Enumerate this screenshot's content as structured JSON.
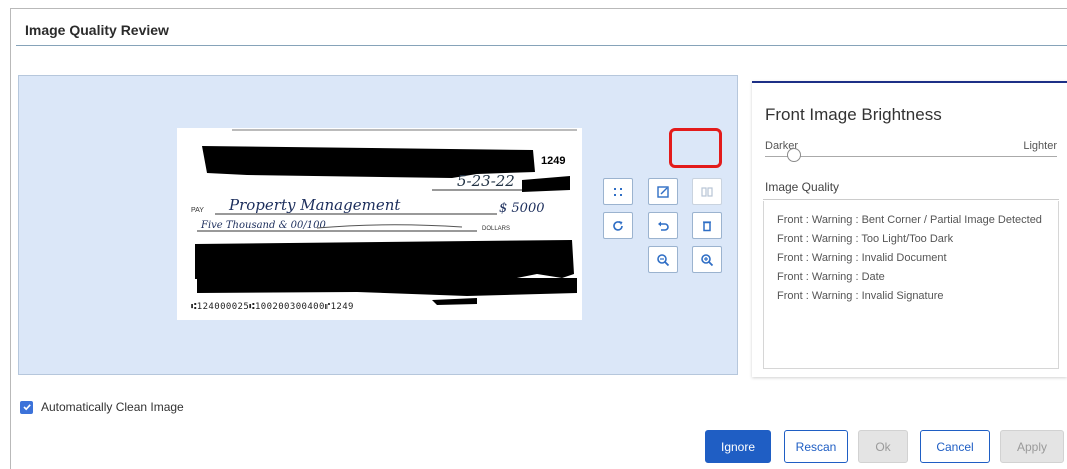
{
  "dialog": {
    "title": "Image Quality Review"
  },
  "check": {
    "check_number": "1249",
    "date": "5-23-22",
    "pay_prefix": "PAY",
    "payee": "Property Management",
    "amount": "$ 5000",
    "amount_words": "Five Thousand & 00/100",
    "dollars_suffix": "DOLLARS",
    "micr": "⑆124000025⑆100200300400⑈1249"
  },
  "toolbar": {
    "buttons": [
      {
        "name": "crop-button",
        "icon": "crop-icon"
      },
      {
        "name": "edit-button",
        "icon": "edit-icon"
      },
      {
        "name": "compare-button",
        "icon": "compare-icon",
        "disabled": true
      },
      {
        "name": "rotate-clockwise-button",
        "icon": "rotate-cw-icon"
      },
      {
        "name": "undo-button",
        "icon": "undo-icon"
      },
      {
        "name": "delete-button",
        "icon": "trash-icon",
        "highlighted": true
      },
      {
        "name": "zoom-out-button",
        "icon": "zoom-out-icon"
      },
      {
        "name": "zoom-in-button",
        "icon": "zoom-in-icon"
      }
    ]
  },
  "brightness": {
    "title": "Front Image Brightness",
    "darker_label": "Darker",
    "lighter_label": "Lighter",
    "level": 0.1
  },
  "image_quality": {
    "heading": "Image Quality",
    "warnings": [
      "Front : Warning : Bent Corner / Partial Image Detected",
      "Front : Warning : Too Light/Too Dark",
      "Front : Warning : Invalid Document",
      "Front : Warning : Date",
      "Front : Warning : Invalid Signature"
    ]
  },
  "auto_clean": {
    "label": "Automatically Clean Image",
    "checked": true
  },
  "buttons": {
    "ignore": "Ignore",
    "rescan": "Rescan",
    "ok": "Ok",
    "cancel": "Cancel",
    "apply": "Apply"
  },
  "colors": {
    "accent": "#1f5ec4",
    "preview_bg": "#dbe7f8",
    "highlight": "#e31b1b",
    "panel_top_border": "#1d2f86"
  }
}
